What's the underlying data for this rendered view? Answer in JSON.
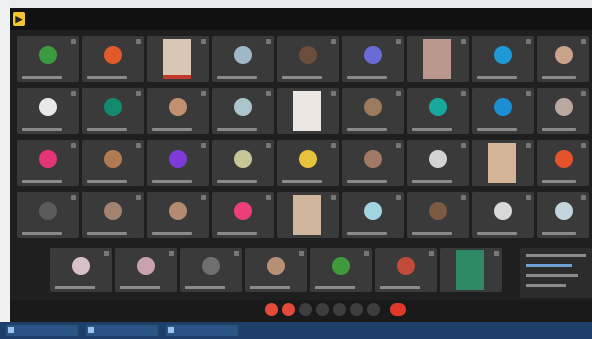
{
  "app": {
    "logo_glyph": "▶"
  },
  "meeting": {
    "info_text": ""
  },
  "taskbar": {
    "items": [
      {
        "icon": "window-icon",
        "label": ""
      },
      {
        "icon": "window-icon",
        "label": ""
      },
      {
        "icon": "window-icon",
        "label": ""
      }
    ]
  },
  "colors": {
    "background": "#1f1f1f",
    "tile": "#3a3a3a",
    "end_call": "#e0382b",
    "taskbar": "#1d3f6a"
  }
}
